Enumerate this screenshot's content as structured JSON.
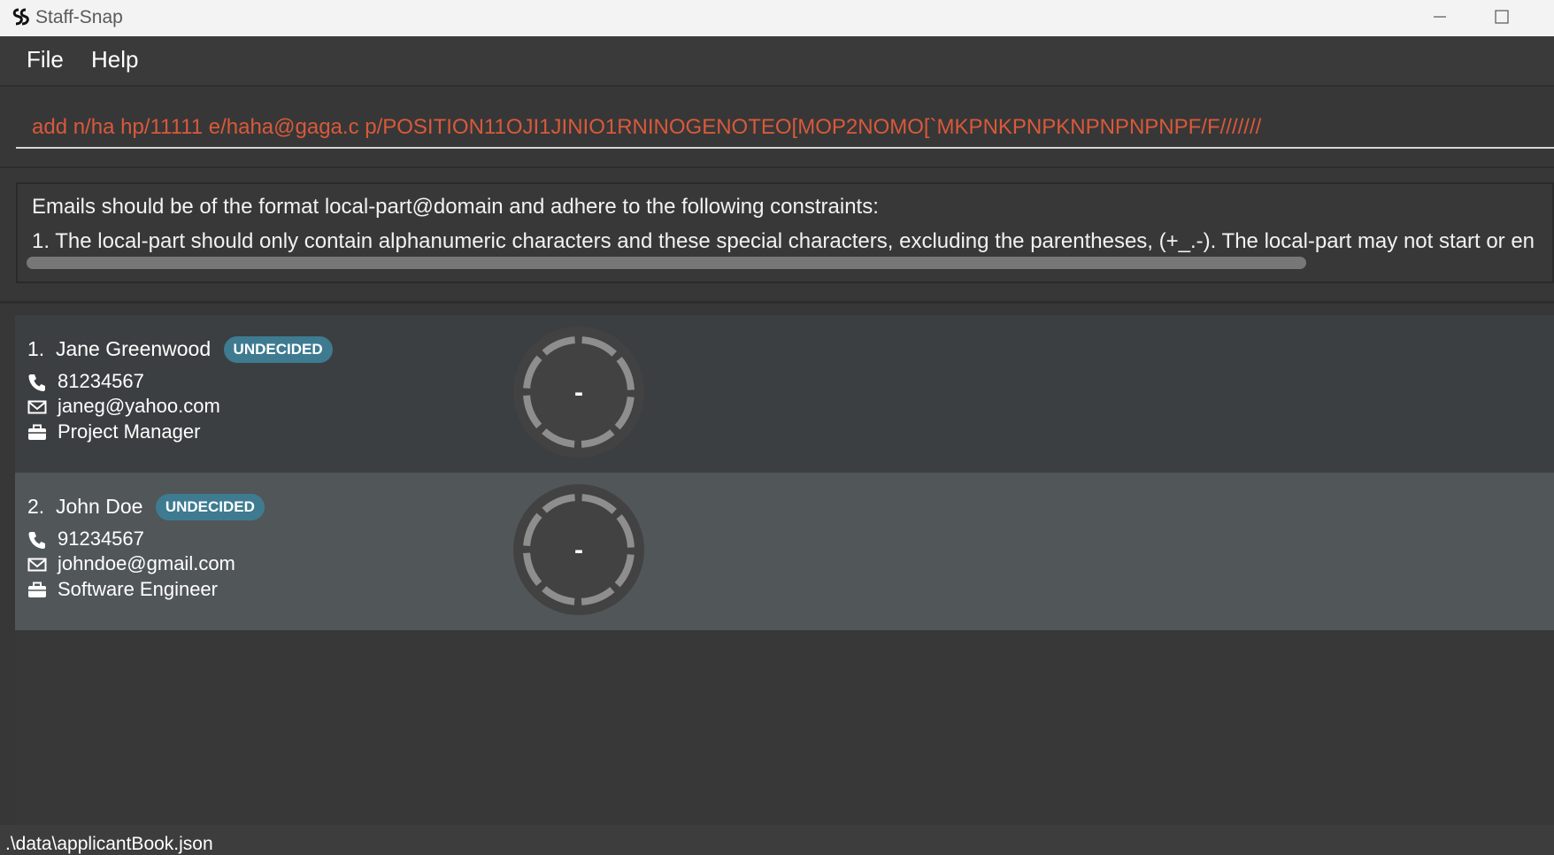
{
  "window": {
    "title": "Staff-Snap"
  },
  "menu": {
    "file": "File",
    "help": "Help"
  },
  "command": {
    "value": "add n/ha hp/11111 e/haha@gaga.c p/POSITION11OJI1JINIO1RNINOGENOTEO[MOP2NOMO[`MKPNKPNPKNPNPNPNPF/F///////"
  },
  "result": {
    "line1": "Emails should be of the format local-part@domain and adhere to the following constraints:",
    "line2": "1. The local-part should only contain alphanumeric characters and these special characters, excluding the parentheses, (+_.-). The local-part may not start or en"
  },
  "applicants": [
    {
      "index": "1.",
      "name": "Jane Greenwood",
      "status": "UNDECIDED",
      "phone": "81234567",
      "email": "janeg@yahoo.com",
      "position": "Project Manager",
      "rating": "-"
    },
    {
      "index": "2.",
      "name": "John Doe",
      "status": "UNDECIDED",
      "phone": "91234567",
      "email": "johndoe@gmail.com",
      "position": "Software Engineer",
      "rating": "-"
    }
  ],
  "status": {
    "path": ".\\data\\applicantBook.json"
  },
  "colors": {
    "accent_error": "#d9593b",
    "badge": "#3e7b91",
    "background": "#373737"
  }
}
